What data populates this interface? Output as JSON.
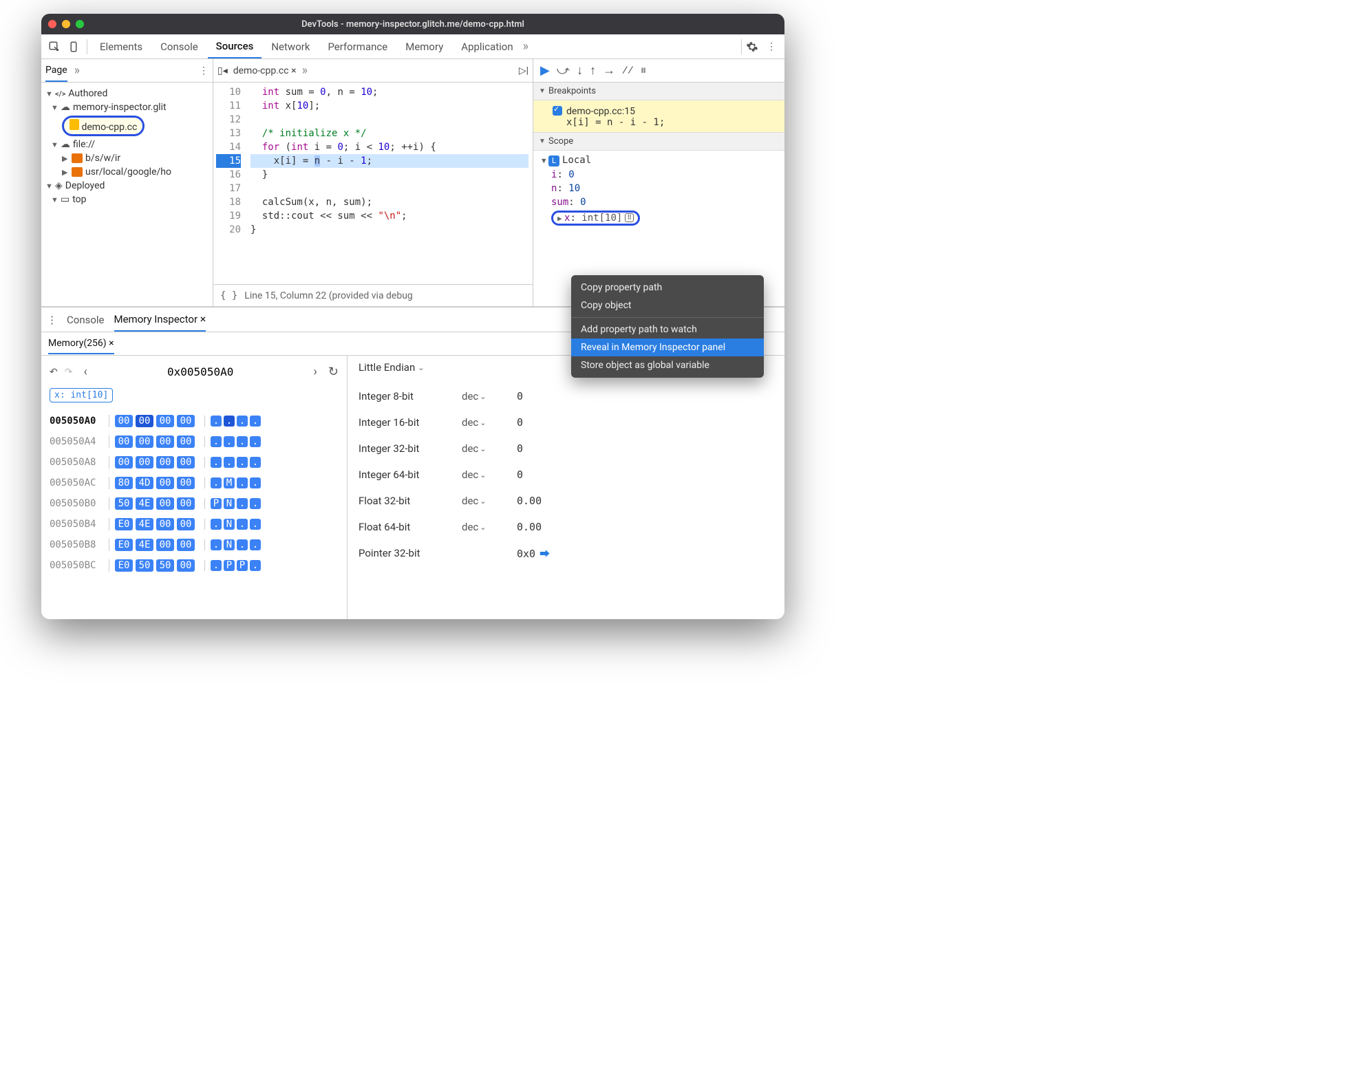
{
  "window": {
    "title": "DevTools - memory-inspector.glitch.me/demo-cpp.html"
  },
  "top_tabs": {
    "elements": "Elements",
    "console": "Console",
    "sources": "Sources",
    "network": "Network",
    "performance": "Performance",
    "memory": "Memory",
    "application": "Application"
  },
  "sidebar": {
    "page_tab": "Page",
    "authored": "Authored",
    "domain": "memory-inspector.glit",
    "file": "demo-cpp.cc",
    "file_scheme": "file://",
    "folder1": "b/s/w/ir",
    "folder2": "usr/local/google/ho",
    "deployed": "Deployed",
    "top": "top"
  },
  "editor": {
    "tab": "demo-cpp.cc",
    "lines": {
      "start": 10,
      "count": 11
    },
    "code": {
      "l10_a": "int",
      "l10_b": " sum = ",
      "l10_c": "0",
      "l10_d": ", n = ",
      "l10_e": "10",
      "l10_f": ";",
      "l11_a": "int",
      "l11_b": " x[",
      "l11_c": "10",
      "l11_d": "];",
      "l12": "",
      "l13": "/* initialize x */",
      "l14_a": "for",
      "l14_b": " (",
      "l14_c": "int",
      "l14_d": " i = ",
      "l14_e": "0",
      "l14_f": "; i < ",
      "l14_g": "10",
      "l14_h": "; ++i) {",
      "l15_a": "  x[i] = ",
      "l15_sel": "n",
      "l15_b": " - i - ",
      "l15_c": "1",
      "l15_d": ";",
      "l16": "}",
      "l17": "",
      "l18_a": "calcSum(x, n, sum);",
      "l19_a": "std::cout << sum << ",
      "l19_b": "\"\\n\"",
      "l19_c": ";",
      "l20": "}"
    },
    "status": "Line 15, Column 22  (provided via debug"
  },
  "debugger": {
    "breakpoints_h": "Breakpoints",
    "bp_file": "demo-cpp.cc:15",
    "bp_line": "x[i] = n - i - 1;",
    "scope_h": "Scope",
    "local": "Local",
    "vars": {
      "i_name": "i",
      "i_val": "0",
      "n_name": "n",
      "n_val": "10",
      "sum_name": "sum",
      "sum_val": "0",
      "x_name": "x",
      "x_type": "int[10]"
    }
  },
  "context_menu": {
    "copy_path": "Copy property path",
    "copy_obj": "Copy object",
    "add_watch": "Add property path to watch",
    "reveal": "Reveal in Memory Inspector panel",
    "store": "Store object as global variable"
  },
  "drawer": {
    "console_tab": "Console",
    "mi_tab": "Memory Inspector",
    "sub_tab": "Memory(256)",
    "address": "0x005050A0",
    "chip": "x: int[10]",
    "rows": [
      {
        "addr": "005050A0",
        "b": [
          "00",
          "00",
          "00",
          "00"
        ],
        "a": [
          ".",
          ".",
          ".",
          "."
        ],
        "bold": true,
        "cursor": 1
      },
      {
        "addr": "005050A4",
        "b": [
          "00",
          "00",
          "00",
          "00"
        ],
        "a": [
          ".",
          ".",
          ".",
          "."
        ]
      },
      {
        "addr": "005050A8",
        "b": [
          "00",
          "00",
          "00",
          "00"
        ],
        "a": [
          ".",
          ".",
          ".",
          "."
        ]
      },
      {
        "addr": "005050AC",
        "b": [
          "80",
          "4D",
          "00",
          "00"
        ],
        "a": [
          ".",
          "M",
          ".",
          "."
        ]
      },
      {
        "addr": "005050B0",
        "b": [
          "50",
          "4E",
          "00",
          "00"
        ],
        "a": [
          "P",
          "N",
          ".",
          "."
        ]
      },
      {
        "addr": "005050B4",
        "b": [
          "E0",
          "4E",
          "00",
          "00"
        ],
        "a": [
          ".",
          "N",
          ".",
          "."
        ]
      },
      {
        "addr": "005050B8",
        "b": [
          "E0",
          "4E",
          "00",
          "00"
        ],
        "a": [
          ".",
          "N",
          ".",
          "."
        ]
      },
      {
        "addr": "005050BC",
        "b": [
          "E0",
          "50",
          "50",
          "00"
        ],
        "a": [
          ".",
          "P",
          "P",
          "."
        ]
      }
    ],
    "endian": "Little Endian",
    "values": [
      {
        "label": "Integer 8-bit",
        "unit": "dec",
        "val": "0"
      },
      {
        "label": "Integer 16-bit",
        "unit": "dec",
        "val": "0"
      },
      {
        "label": "Integer 32-bit",
        "unit": "dec",
        "val": "0"
      },
      {
        "label": "Integer 64-bit",
        "unit": "dec",
        "val": "0"
      },
      {
        "label": "Float 32-bit",
        "unit": "dec",
        "val": "0.00"
      },
      {
        "label": "Float 64-bit",
        "unit": "dec",
        "val": "0.00"
      },
      {
        "label": "Pointer 32-bit",
        "unit": "",
        "val": "0x0",
        "arrow": true
      }
    ]
  }
}
